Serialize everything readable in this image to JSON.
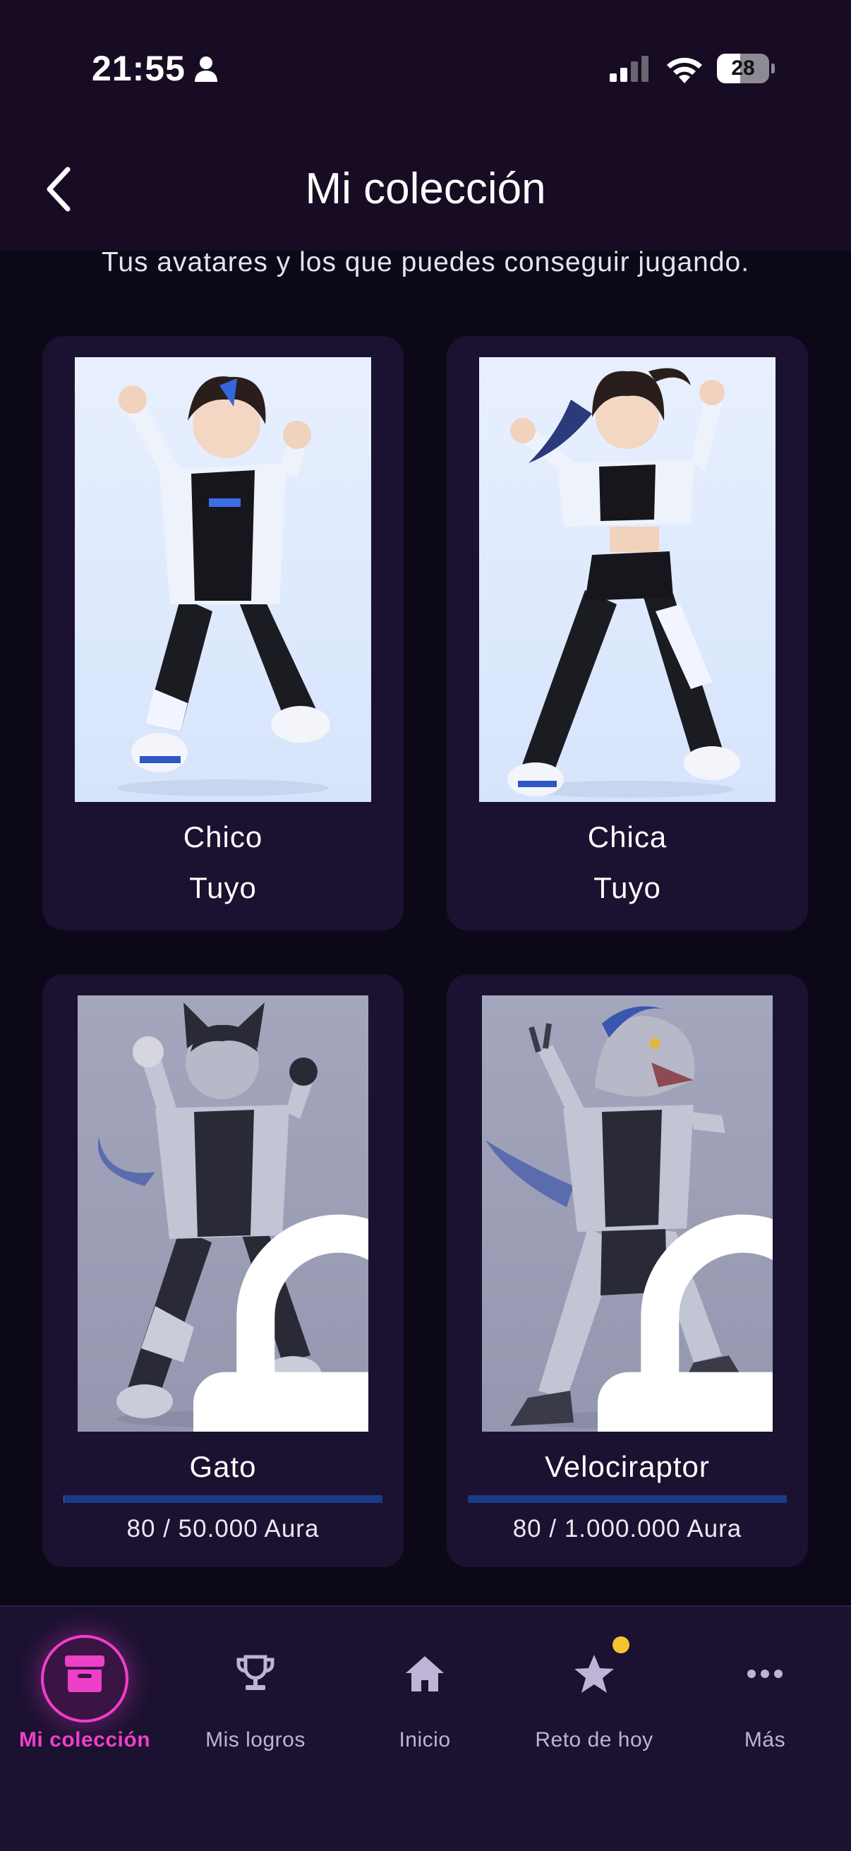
{
  "status_bar": {
    "time": "21:55",
    "battery": "28"
  },
  "header": {
    "title": "Mi colección",
    "subtitle": "Tus avatares y los que puedes conseguir jugando."
  },
  "cards": [
    {
      "name": "Chico",
      "status": "Tuyo",
      "locked": false
    },
    {
      "name": "Chica",
      "status": "Tuyo",
      "locked": false
    },
    {
      "name": "Gato",
      "progress_text": "80 / 50.000 Aura",
      "progress": 0.0016,
      "locked": true
    },
    {
      "name": "Velociraptor",
      "progress_text": "80 / 1.000.000 Aura",
      "progress": 8e-05,
      "locked": true
    }
  ],
  "bottom_nav": {
    "items": [
      {
        "label": "Mi colección",
        "icon": "archive-icon",
        "active": true
      },
      {
        "label": "Mis logros",
        "icon": "trophy-icon",
        "active": false
      },
      {
        "label": "Inicio",
        "icon": "home-icon",
        "active": false
      },
      {
        "label": "Reto de hoy",
        "icon": "star-icon",
        "active": false,
        "badge": true
      },
      {
        "label": "Más",
        "icon": "more-icon",
        "active": false
      }
    ]
  },
  "colors": {
    "accent": "#ee3fc9",
    "background": "#0c0818",
    "card": "#1b1130",
    "progress": "#1a3a86",
    "badge": "#f6c431"
  }
}
